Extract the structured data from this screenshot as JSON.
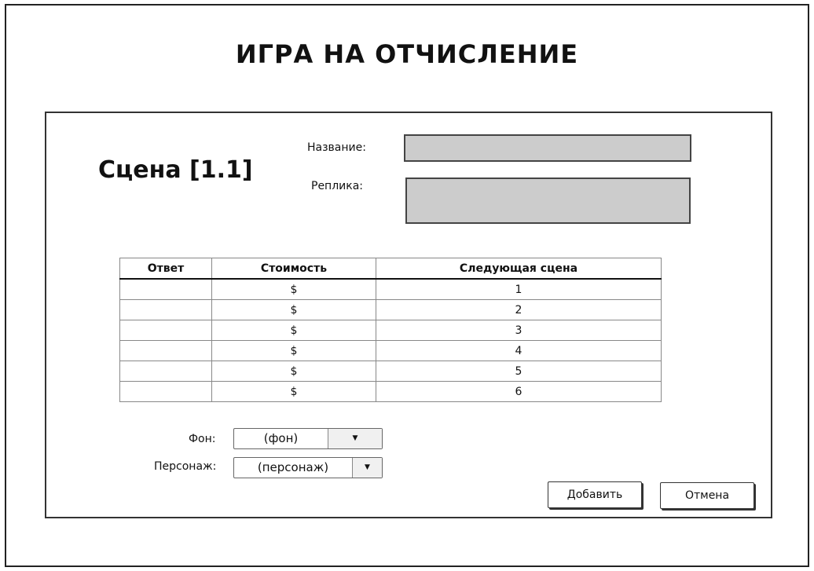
{
  "app": {
    "title": "ИГРА НА ОТЧИСЛЕНИЕ"
  },
  "scene": {
    "title": "Сцена [1.1]",
    "name_label": "Название:",
    "name_value": "",
    "line_label": "Реплика:",
    "line_value": ""
  },
  "table": {
    "headers": [
      "Ответ",
      "Стоимость",
      "Следующая сцена"
    ],
    "rows": [
      {
        "answer": "",
        "cost": "$",
        "next": "1"
      },
      {
        "answer": "",
        "cost": "$",
        "next": "2"
      },
      {
        "answer": "",
        "cost": "$",
        "next": "3"
      },
      {
        "answer": "",
        "cost": "$",
        "next": "4"
      },
      {
        "answer": "",
        "cost": "$",
        "next": "5"
      },
      {
        "answer": "",
        "cost": "$",
        "next": "6"
      }
    ]
  },
  "background": {
    "label": "Фон:",
    "selected": "(фон)"
  },
  "character": {
    "label": "Персонаж:",
    "selected": "(персонаж)"
  },
  "buttons": {
    "add": "Добавить",
    "cancel": "Отмена"
  },
  "icons": {
    "dropdown": "▼"
  }
}
